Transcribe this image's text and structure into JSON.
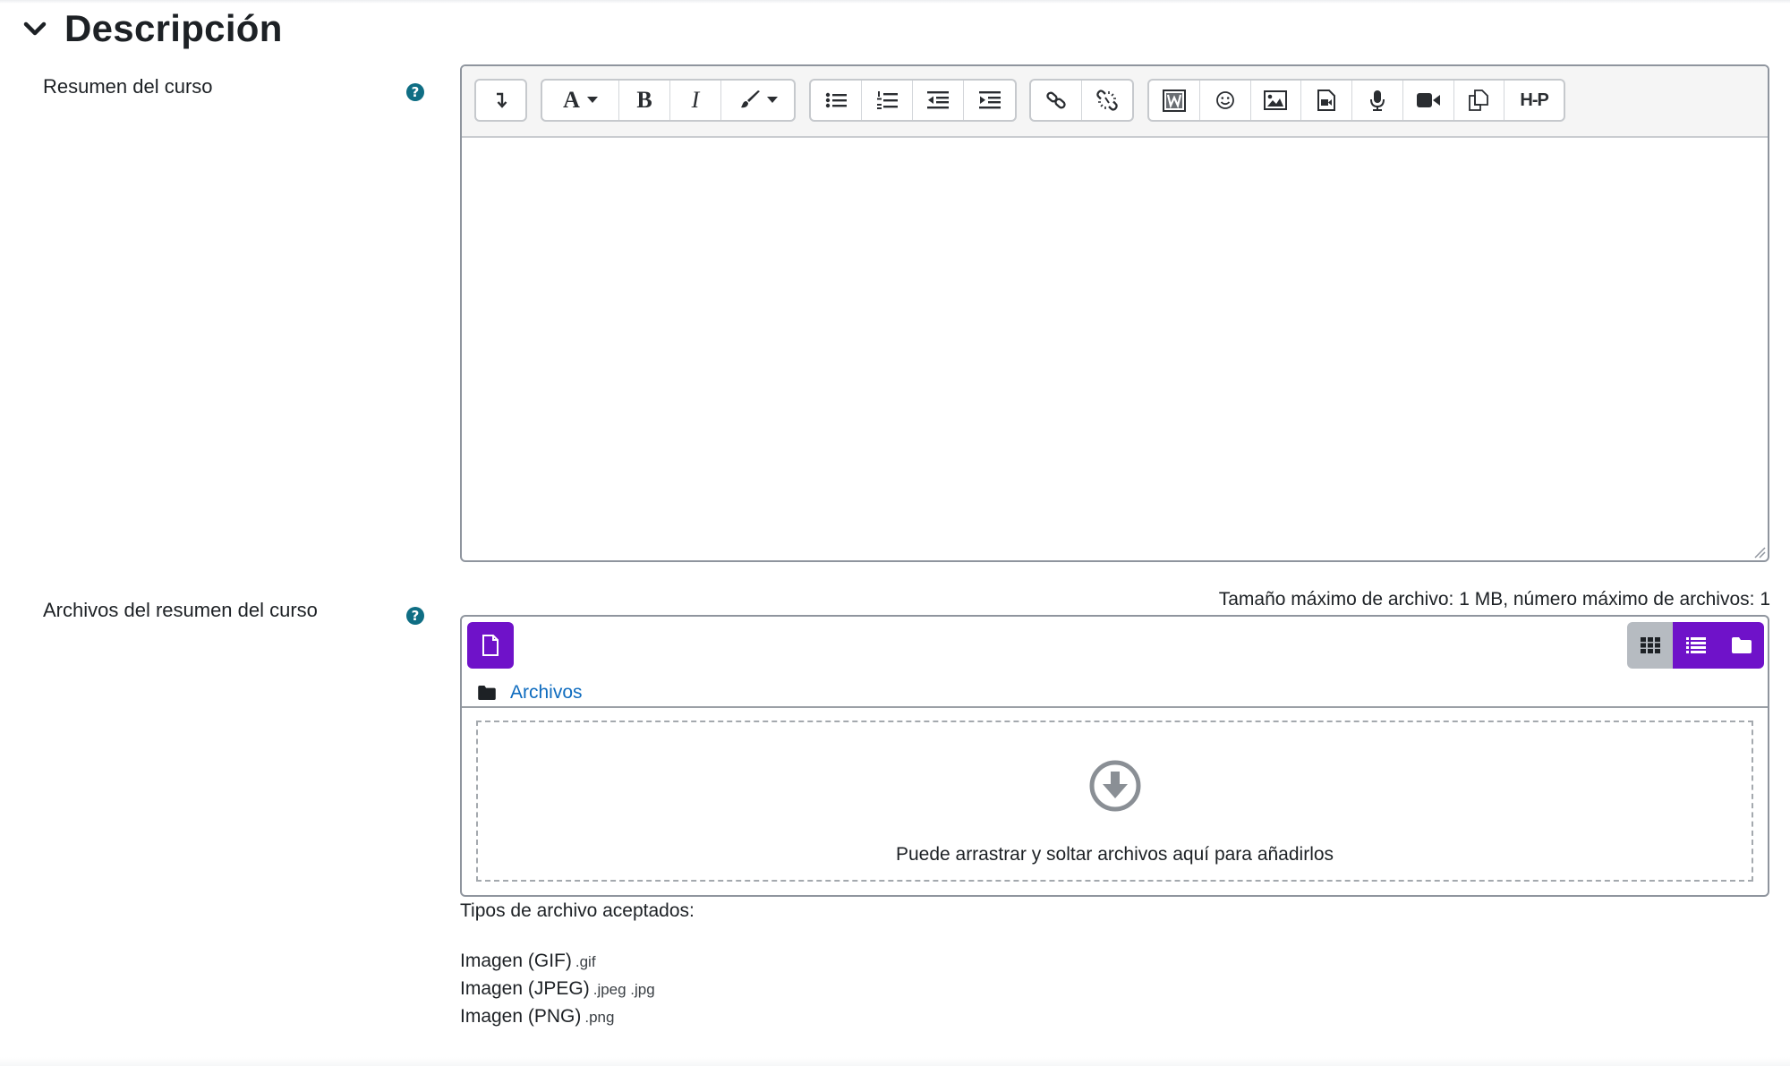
{
  "section": {
    "title": "Descripción"
  },
  "summary": {
    "label": "Resumen del curso",
    "help": "?"
  },
  "toolbar": {
    "groups": [
      [
        "expand-toolbar"
      ],
      [
        "font-style",
        "bold",
        "italic",
        "text-color"
      ],
      [
        "bullet-list",
        "numbered-list",
        "outdent",
        "indent"
      ],
      [
        "link",
        "unlink"
      ],
      [
        "paste-word",
        "emoji",
        "image",
        "media",
        "record-audio",
        "record-video",
        "manage-files",
        "h5p"
      ]
    ],
    "h5p_label": "H-P",
    "font_label": "A",
    "bold_label": "B",
    "italic_label": "I"
  },
  "files": {
    "label": "Archivos del resumen del curso",
    "help": "?",
    "max_size": "Tamaño máximo de archivo: 1 MB, número máximo de archivos: 1",
    "path_link": "Archivos",
    "drop_text": "Puede arrastrar y soltar archivos aquí para añadirlos",
    "accepted_title": "Tipos de archivo aceptados:",
    "types": [
      {
        "name": "Imagen (GIF)",
        "ext": ".gif"
      },
      {
        "name": "Imagen (JPEG)",
        "ext": ".jpeg .jpg"
      },
      {
        "name": "Imagen (PNG)",
        "ext": ".png"
      }
    ]
  },
  "colors": {
    "accent": "#6f12c9",
    "link": "#0f6cbf",
    "help": "#0f6e84"
  }
}
